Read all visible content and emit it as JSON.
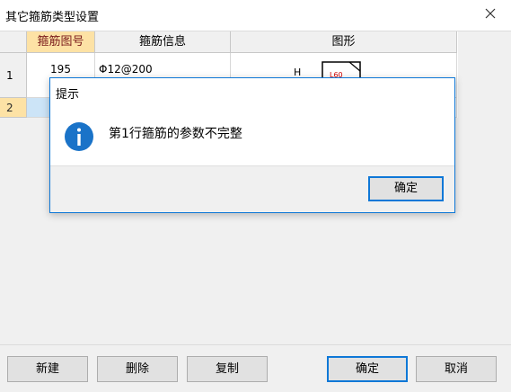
{
  "window": {
    "title": "其它箍筋类型设置"
  },
  "grid": {
    "columns": [
      "箍筋图号",
      "箍筋信息",
      "图形"
    ],
    "rows": [
      {
        "num": "1",
        "fig_no": "195",
        "info": "Φ12@200",
        "shape_label": "H",
        "shape_dim": "L60"
      },
      {
        "num": "2",
        "fig_no": "",
        "info": "",
        "shape_label": "",
        "shape_dim": ""
      }
    ],
    "selected_row": 2
  },
  "message_box": {
    "title": "提示",
    "icon": "info-icon",
    "message": "第1行箍筋的参数不完整",
    "ok_label": "确定"
  },
  "buttons": {
    "new": "新建",
    "delete": "删除",
    "copy": "复制",
    "ok": "确定",
    "cancel": "取消"
  },
  "colors": {
    "accent": "#0f78d7",
    "header_selected": "#fde2a5",
    "row_selected": "#cce4f7"
  }
}
